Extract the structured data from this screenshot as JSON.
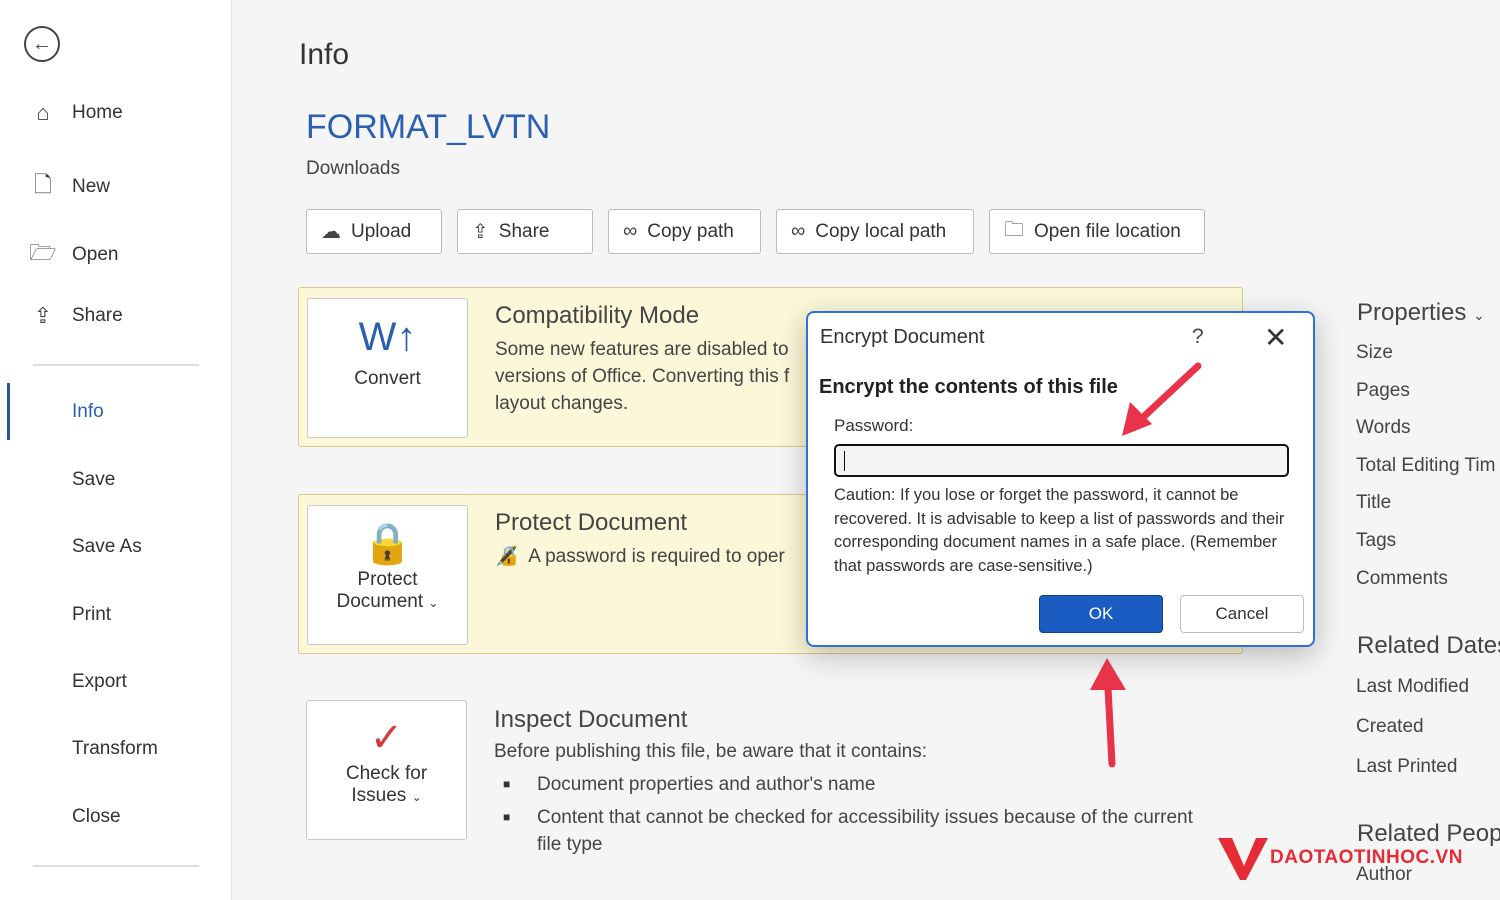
{
  "sidebar": {
    "items": [
      {
        "label": "Home",
        "icon": "home-icon"
      },
      {
        "label": "New",
        "icon": "new-document-icon"
      },
      {
        "label": "Open",
        "icon": "folder-open-icon"
      },
      {
        "label": "Share",
        "icon": "share-icon"
      },
      {
        "label": "Info"
      },
      {
        "label": "Save"
      },
      {
        "label": "Save As"
      },
      {
        "label": "Print"
      },
      {
        "label": "Export"
      },
      {
        "label": "Transform"
      },
      {
        "label": "Close"
      }
    ],
    "active": "Info"
  },
  "header": {
    "title": "Info",
    "file_name": "FORMAT_LVTN",
    "location": "Downloads"
  },
  "toolbar": {
    "upload": "Upload",
    "share": "Share",
    "copy_path": "Copy path",
    "copy_local_path": "Copy local path",
    "open_location": "Open file location"
  },
  "compat": {
    "button": "Convert",
    "title": "Compatibility Mode",
    "text1": "Some new features are disabled to",
    "text2": "versions of Office. Converting this f",
    "text3": "layout changes."
  },
  "protect": {
    "button1": "Protect",
    "button2": "Document",
    "title": "Protect Document",
    "text": "A password is required to oper"
  },
  "inspect": {
    "button1": "Check for",
    "button2": "Issues",
    "title": "Inspect Document",
    "text": "Before publishing this file, be aware that it contains:",
    "bullets": [
      "Document properties and author's name",
      "Content that cannot be checked for accessibility issues because of the current",
      "file type"
    ]
  },
  "properties": {
    "title": "Properties",
    "items": [
      "Size",
      "Pages",
      "Words",
      "Total Editing Tim",
      "Title",
      "Tags",
      "Comments"
    ],
    "dates_title": "Related Dates",
    "dates": [
      "Last Modified",
      "Created",
      "Last Printed"
    ],
    "people_title": "Related Peopl",
    "people": [
      "Author"
    ]
  },
  "dialog": {
    "title": "Encrypt Document",
    "help": "?",
    "heading": "Encrypt the contents of this file",
    "password_label": "Password:",
    "password_value": "",
    "caution": "Caution: If you lose or forget the password, it cannot be recovered. It is advisable to keep a list of passwords and their corresponding document names in a safe place. (Remember that passwords are case-sensitive.)",
    "ok": "OK",
    "cancel": "Cancel"
  },
  "watermark": {
    "text": "DAOTAOTINHOC.VN"
  },
  "colors": {
    "accent": "#2b5fb0",
    "ok_button": "#1a5cc2",
    "annotation_arrow": "#e8334a",
    "banner": "#fbf7d8"
  }
}
